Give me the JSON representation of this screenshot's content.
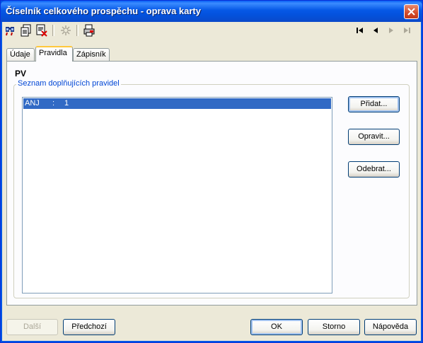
{
  "window": {
    "title": "Číselník celkového prospěchu - oprava karty"
  },
  "toolbar": {
    "icons": [
      "find-icon",
      "copy-record-icon",
      "delete-record-icon",
      "disabled-action-icon",
      "print-icon"
    ],
    "nav": [
      "first-record-icon",
      "previous-record-icon",
      "next-record-icon",
      "last-record-icon"
    ]
  },
  "tabs": [
    {
      "label": "Údaje"
    },
    {
      "label": "Pravidla"
    },
    {
      "label": "Zápisník"
    }
  ],
  "active_tab": "Pravidla",
  "panel": {
    "heading": "PV",
    "group_label": "Seznam doplňujících pravidel",
    "rows": [
      {
        "code": "ANJ",
        "sep": ":",
        "value": "1",
        "selected": true
      }
    ],
    "buttons": {
      "add": "Přidat...",
      "edit": "Opravit...",
      "remove": "Odebrat..."
    }
  },
  "footer": {
    "next": "Další",
    "previous": "Předchozí",
    "ok": "OK",
    "cancel": "Storno",
    "help": "Nápověda"
  },
  "colors": {
    "titlebar": "#0658e6",
    "selection": "#316ac5",
    "group_label": "#0046d5",
    "active_tab_accent": "#ffc83c"
  }
}
